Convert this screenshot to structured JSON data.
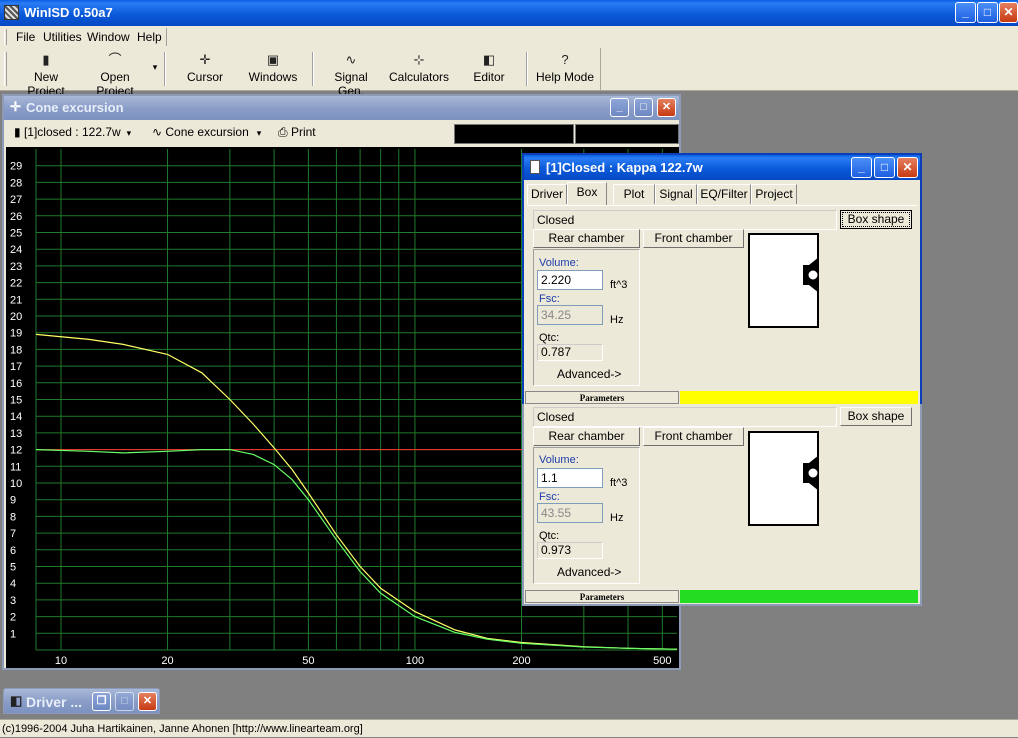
{
  "app": {
    "title": "WinISD 0.50a7"
  },
  "menu": [
    "File",
    "Utilities",
    "Window",
    "Help"
  ],
  "toolbar": [
    {
      "label": "New Project",
      "icon": "new-project-icon",
      "glyph": "▮"
    },
    {
      "label": "Open Project",
      "icon": "open-project-icon",
      "glyph": "⌒"
    },
    {
      "label": "Cursor",
      "icon": "cursor-icon",
      "glyph": "✛"
    },
    {
      "label": "Windows",
      "icon": "windows-icon",
      "glyph": "▣"
    },
    {
      "label": "Signal Gen.",
      "icon": "signal-gen-icon",
      "glyph": "∿"
    },
    {
      "label": "Calculators",
      "icon": "calculators-icon",
      "glyph": "⊹"
    },
    {
      "label": "Editor",
      "icon": "editor-icon",
      "glyph": "◧"
    },
    {
      "label": "Help Mode",
      "icon": "help-icon",
      "glyph": "?"
    }
  ],
  "cone_window": {
    "title": "Cone excursion",
    "project_combo": "[1]closed : 122.7w",
    "graph_combo": "Cone excursion",
    "print_label": "Print"
  },
  "chart_data": {
    "type": "line",
    "title": "",
    "xlabel": "",
    "ylabel": "",
    "x_scale": "log",
    "xlim": [
      8.5,
      550
    ],
    "ylim": [
      0,
      30
    ],
    "x_ticks": [
      10,
      20,
      50,
      100,
      200,
      500
    ],
    "y_ticks": [
      1,
      2,
      3,
      4,
      5,
      6,
      7,
      8,
      9,
      10,
      11,
      12,
      13,
      14,
      15,
      16,
      17,
      18,
      19,
      20,
      21,
      22,
      23,
      24,
      25,
      26,
      27,
      28,
      29
    ],
    "grid": true,
    "reference_line": {
      "y": 12,
      "color": "#ff3030"
    },
    "series": [
      {
        "color": "#ffff66",
        "x": [
          8.5,
          12,
          15,
          20,
          25,
          30,
          35,
          40,
          45,
          50,
          60,
          70,
          80,
          100,
          130,
          160,
          200,
          300,
          400,
          550
        ],
        "y": [
          18.9,
          18.6,
          18.3,
          17.7,
          16.6,
          15.0,
          13.5,
          12.1,
          10.8,
          9.4,
          6.9,
          5.0,
          3.7,
          2.3,
          1.2,
          0.7,
          0.45,
          0.2,
          0.1,
          0.05
        ]
      },
      {
        "color": "#66ff66",
        "x": [
          8.5,
          12,
          15,
          20,
          25,
          30,
          35,
          40,
          45,
          50,
          60,
          70,
          80,
          100,
          130,
          160,
          200,
          300,
          400,
          550
        ],
        "y": [
          12.0,
          11.9,
          11.8,
          11.9,
          12.0,
          12.0,
          11.7,
          11.1,
          10.2,
          9.0,
          6.6,
          4.7,
          3.4,
          2.0,
          1.05,
          0.65,
          0.4,
          0.18,
          0.1,
          0.05
        ]
      }
    ]
  },
  "kappa": {
    "title": "[1]Closed : Kappa 122.7w",
    "tabs": [
      "Driver",
      "Box",
      "Plot",
      "Signal",
      "EQ/Filter",
      "Project"
    ],
    "active_tab": "Box"
  },
  "box1": {
    "type": "Closed",
    "shape_btn": "Box shape",
    "rear": "Rear chamber",
    "front": "Front chamber",
    "volume_label": "Volume:",
    "volume": "2.220",
    "volume_unit": "ft^3",
    "fsc_label": "Fsc:",
    "fsc": "34.25",
    "fsc_unit": "Hz",
    "qtc_label": "Qtc:",
    "qtc": "0.787",
    "advanced": "Advanced->",
    "params": "Parameters",
    "color": "#ffff00"
  },
  "box2": {
    "type": "Closed",
    "shape_btn": "Box shape",
    "rear": "Rear chamber",
    "front": "Front chamber",
    "volume_label": "Volume:",
    "volume": "1.1",
    "volume_unit": "ft^3",
    "fsc_label": "Fsc:",
    "fsc": "43.55",
    "fsc_unit": "Hz",
    "qtc_label": "Qtc:",
    "qtc": "0.973",
    "advanced": "Advanced->",
    "params": "Parameters",
    "color": "#22dd22"
  },
  "driver_min": {
    "title": "Driver ..."
  },
  "status": "(c)1996-2004 Juha Hartikainen, Janne Ahonen [http://www.linearteam.org]"
}
